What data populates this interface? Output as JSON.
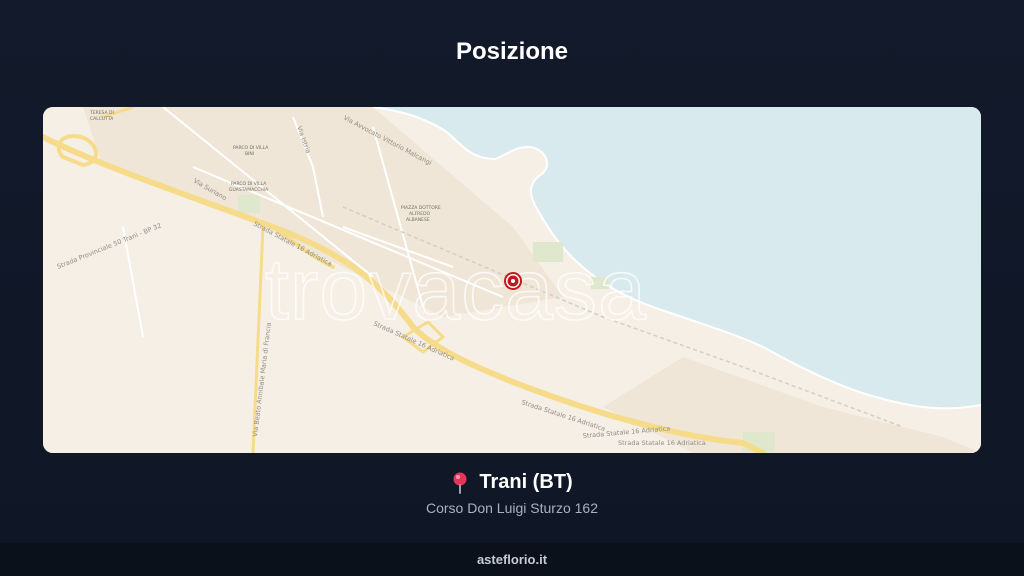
{
  "header": {
    "title": "Posizione"
  },
  "map": {
    "watermark": "trovacasa",
    "marker_color": "#c4161c",
    "sea_color": "#d9eaef",
    "land_color": "#f6efe6",
    "road_color": "#f6dc8a",
    "streets": {
      "via_avvocato": "Via Avvocato Vittorio Malcangi",
      "via_istria": "Via Istria",
      "via_suriano": "Via Suriano",
      "strada_provinciale": "Strada Provinciale 50 Trani - BP 32",
      "statale_1": "Strada Statale 16 Adriatica",
      "statale_2": "Strada Statale 16 Adriatica",
      "statale_3": "Strada Statale 16 Adriatica",
      "statale_4": "Strada Statale 16 Adriatica",
      "statale_5": "Strada Statale 16 Adriatica",
      "via_beato": "Via Beato Annibale Maria di Francia"
    },
    "places": {
      "teresa_line1": "TERESA DI",
      "teresa_line2": "CALCUTTA",
      "parco_villa_line1": "PARCO DI VILLA",
      "parco_villa_line2": "BINI",
      "parco_guastamacchia_line1": "PARCO DI VILLA",
      "parco_guastamacchia_line2": "GUASTAMACCHIA",
      "piazza_line1": "PIAZZA DOTTORE",
      "piazza_line2": "ALFREDO",
      "piazza_line3": "ALBANESE"
    }
  },
  "location": {
    "pin_icon": "round-pushpin-icon",
    "city": "Trani (BT)",
    "address": "Corso Don Luigi Sturzo 162"
  },
  "footer": {
    "brand": "asteflorio.it"
  }
}
